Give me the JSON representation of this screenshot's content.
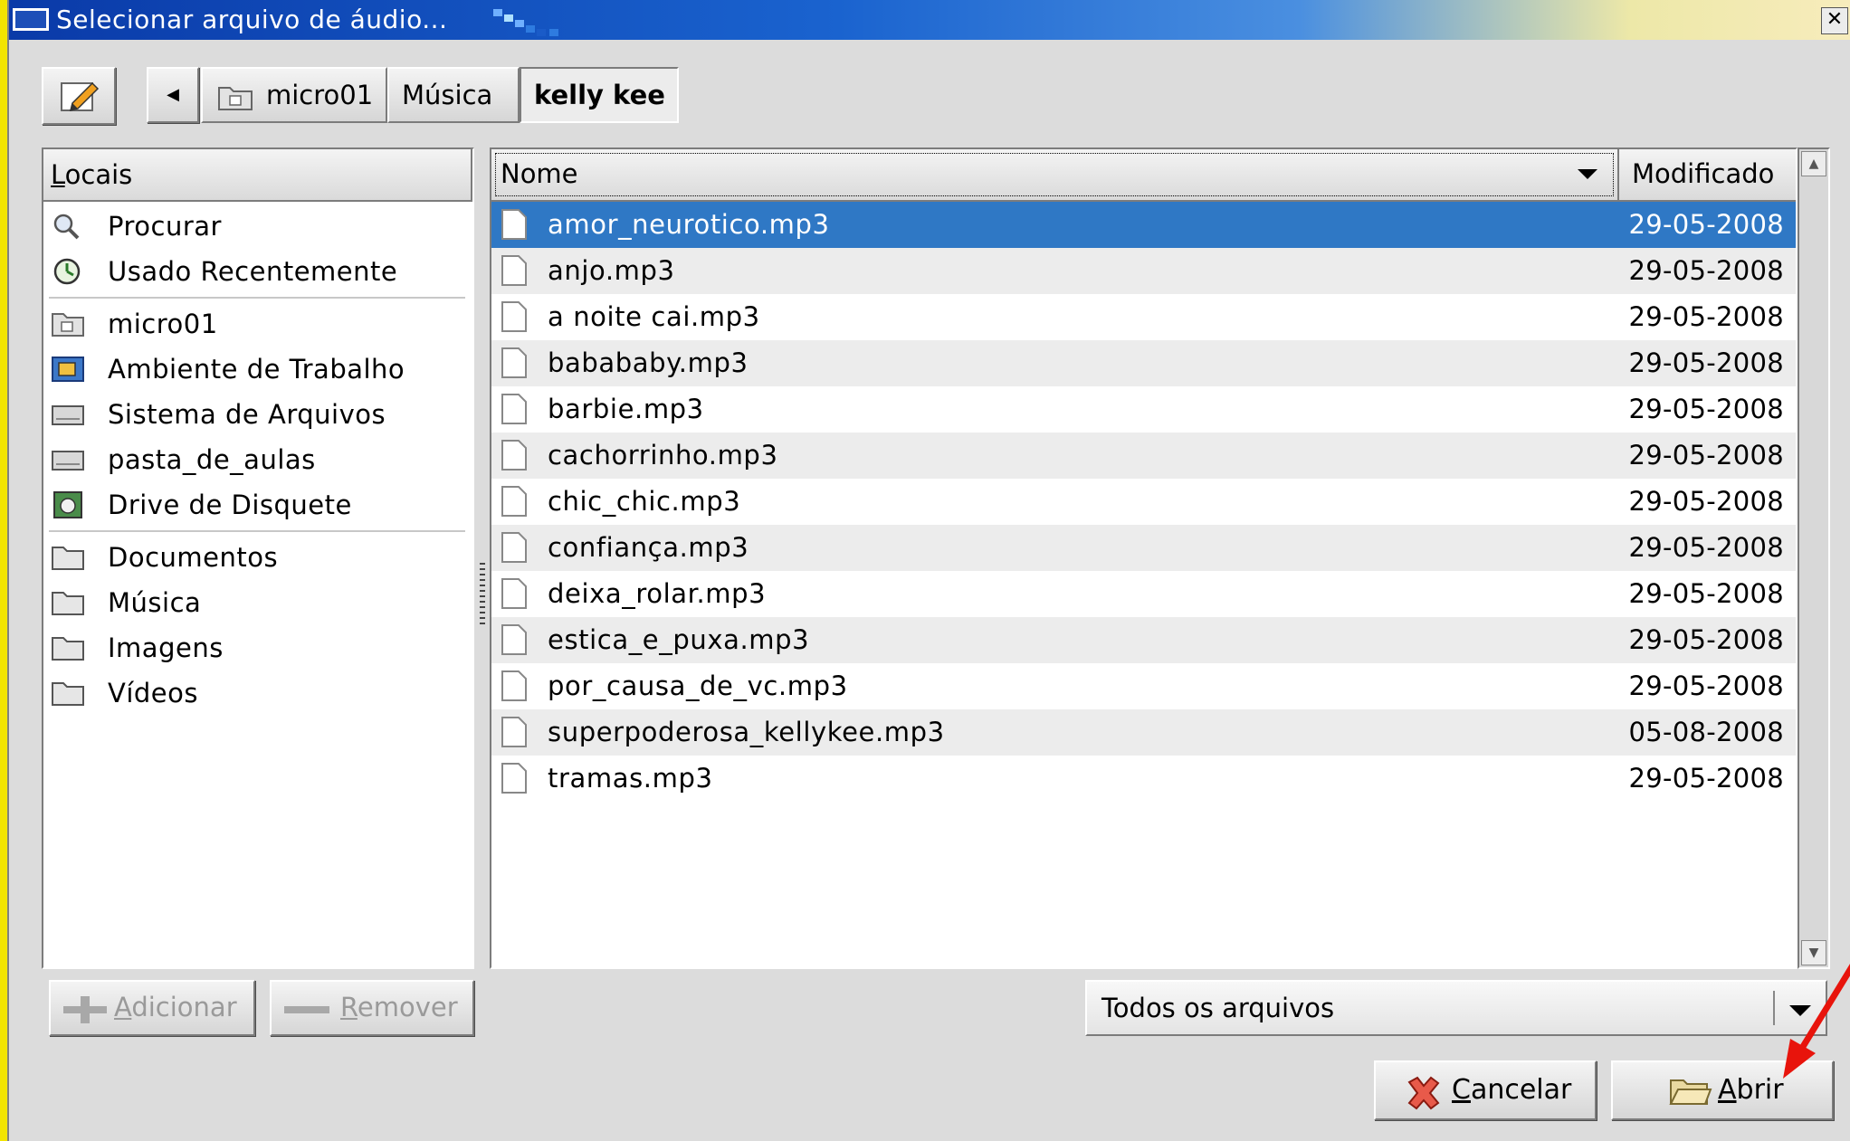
{
  "window": {
    "title": "Selecionar arquivo de áudio..."
  },
  "breadcrumb": {
    "items": [
      "micro01",
      "Música",
      "kelly kee"
    ]
  },
  "places": {
    "header_first": "L",
    "header_rest": "ocais",
    "items": [
      {
        "label": "Procurar",
        "icon": "search-icon"
      },
      {
        "label": "Usado Recentemente",
        "icon": "recent-icon"
      },
      {
        "label": "micro01",
        "icon": "home-folder-icon"
      },
      {
        "label": "Ambiente de Trabalho",
        "icon": "desktop-icon"
      },
      {
        "label": "Sistema de Arquivos",
        "icon": "drive-icon"
      },
      {
        "label": "pasta_de_aulas",
        "icon": "drive-icon"
      },
      {
        "label": "Drive de Disquete",
        "icon": "floppy-icon"
      },
      {
        "label": "Documentos",
        "icon": "folder-icon"
      },
      {
        "label": "Música",
        "icon": "folder-icon"
      },
      {
        "label": "Imagens",
        "icon": "folder-icon"
      },
      {
        "label": "Vídeos",
        "icon": "folder-icon"
      }
    ]
  },
  "filelist": {
    "columns": {
      "name": "Nome",
      "modified": "Modificado"
    },
    "rows": [
      {
        "name": "amor_neurotico.mp3",
        "date": "29-05-2008",
        "selected": true
      },
      {
        "name": "anjo.mp3",
        "date": "29-05-2008"
      },
      {
        "name": "a noite cai.mp3",
        "date": "29-05-2008"
      },
      {
        "name": "babababy.mp3",
        "date": "29-05-2008"
      },
      {
        "name": "barbie.mp3",
        "date": "29-05-2008"
      },
      {
        "name": "cachorrinho.mp3",
        "date": "29-05-2008"
      },
      {
        "name": "chic_chic.mp3",
        "date": "29-05-2008"
      },
      {
        "name": "confiança.mp3",
        "date": "29-05-2008"
      },
      {
        "name": "deixa_rolar.mp3",
        "date": "29-05-2008"
      },
      {
        "name": "estica_e_puxa.mp3",
        "date": "29-05-2008"
      },
      {
        "name": "por_causa_de_vc.mp3",
        "date": "29-05-2008"
      },
      {
        "name": "superpoderosa_kellykee.mp3",
        "date": "05-08-2008"
      },
      {
        "name": "tramas.mp3",
        "date": "29-05-2008"
      }
    ]
  },
  "buttons": {
    "add_first": "A",
    "add_rest": "dicionar",
    "remove_first": "R",
    "remove_rest": "emover",
    "cancel_first": "C",
    "cancel_rest": "ancelar",
    "open_first": "A",
    "open_rest": "brir"
  },
  "filter": {
    "selected": "Todos os arquivos"
  },
  "colors": {
    "selection": "#2f78c5",
    "background": "#f2e400",
    "annotation_arrow": "#e8140c"
  }
}
